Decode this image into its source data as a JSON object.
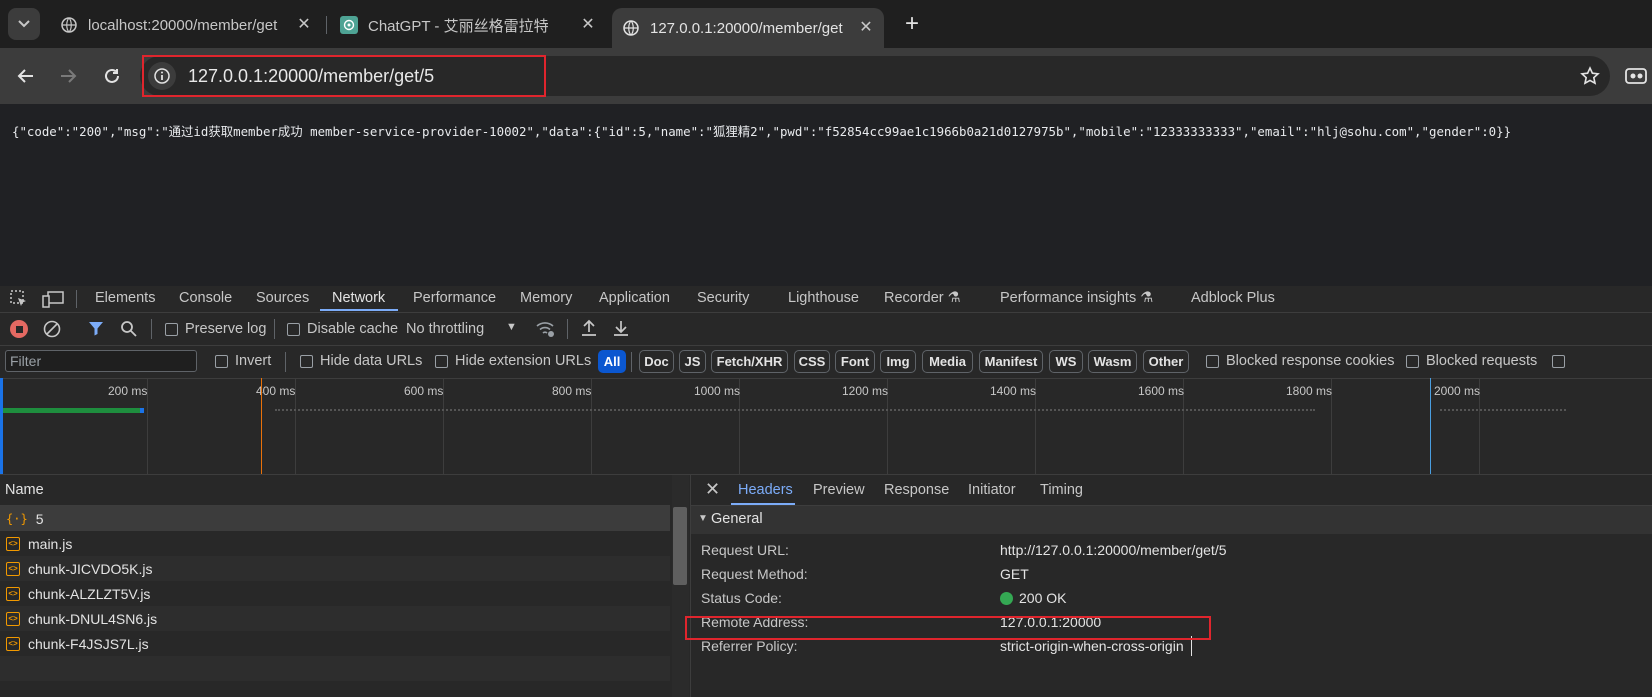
{
  "browser": {
    "tabs": [
      {
        "title": "localhost:20000/member/get",
        "icon": "globe-icon"
      },
      {
        "title": "ChatGPT - 艾丽丝格雷拉特",
        "icon": "chatgpt-icon"
      },
      {
        "title": "127.0.0.1:20000/member/get",
        "icon": "globe-icon",
        "active": true
      }
    ],
    "new_tab": "+",
    "close": "✕",
    "address": "127.0.0.1:20000/member/get/5"
  },
  "page": {
    "json_text": "{\"code\":\"200\",\"msg\":\"通过id获取member成功 member-service-provider-10002\",\"data\":{\"id\":5,\"name\":\"狐狸精2\",\"pwd\":\"f52854cc99ae1c1966b0a21d0127975b\",\"mobile\":\"12333333333\",\"email\":\"hlj@sohu.com\",\"gender\":0}}"
  },
  "devtools": {
    "panels": [
      "Elements",
      "Console",
      "Sources",
      "Network",
      "Performance",
      "Memory",
      "Application",
      "Security",
      "Lighthouse",
      "Recorder",
      "Performance insights",
      "Adblock Plus"
    ],
    "toolbar": {
      "preserve_log": "Preserve log",
      "disable_cache": "Disable cache",
      "throttling": "No throttling"
    },
    "filter": {
      "placeholder": "Filter",
      "invert": "Invert",
      "hide_data_urls": "Hide data URLs",
      "hide_extension_urls": "Hide extension URLs",
      "types": [
        "All",
        "Doc",
        "JS",
        "Fetch/XHR",
        "CSS",
        "Font",
        "Img",
        "Media",
        "Manifest",
        "WS",
        "Wasm",
        "Other"
      ],
      "blocked_response_cookies": "Blocked response cookies",
      "blocked_requests": "Blocked requests"
    },
    "timeline_ticks": [
      "200 ms",
      "400 ms",
      "600 ms",
      "800 ms",
      "1000 ms",
      "1200 ms",
      "1400 ms",
      "1600 ms",
      "1800 ms",
      "2000 ms"
    ],
    "requests": {
      "header": "Name",
      "rows": [
        "5",
        "main.js",
        "chunk-JICVDO5K.js",
        "chunk-ALZLZT5V.js",
        "chunk-DNUL4SN6.js",
        "chunk-F4JSJS7L.js"
      ]
    },
    "detail": {
      "tabs": [
        "Headers",
        "Preview",
        "Response",
        "Initiator",
        "Timing"
      ],
      "section": "General",
      "rows": [
        {
          "key": "Request URL:",
          "value": "http://127.0.0.1:20000/member/get/5"
        },
        {
          "key": "Request Method:",
          "value": "GET"
        },
        {
          "key": "Status Code:",
          "value": "200 OK"
        },
        {
          "key": "Remote Address:",
          "value": "127.0.0.1:20000"
        },
        {
          "key": "Referrer Policy:",
          "value": "strict-origin-when-cross-origin"
        }
      ]
    }
  },
  "colors": {
    "highlight_box": "#e0252d",
    "status_ok": "#1e8e3e",
    "accent": "#7cacf8"
  }
}
